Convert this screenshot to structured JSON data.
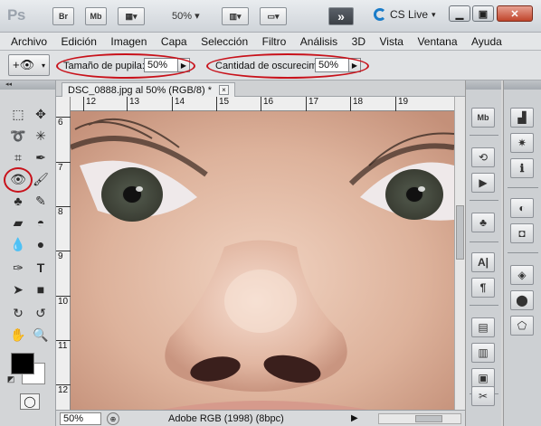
{
  "appbar": {
    "logo": "Ps",
    "br_label": "Br",
    "mb_label": "Mb",
    "zoom": "50%",
    "cs_live": "CS Live",
    "chevron": "»"
  },
  "menu": [
    "Archivo",
    "Edición",
    "Imagen",
    "Capa",
    "Selección",
    "Filtro",
    "Análisis",
    "3D",
    "Vista",
    "Ventana",
    "Ayuda"
  ],
  "options": {
    "pupil_label": "Tamaño de pupila:",
    "pupil_value": "50%",
    "darken_label": "Cantidad de oscurecimiento:",
    "darken_value": "50%"
  },
  "document": {
    "tab_title": "DSC_0888.jpg al 50% (RGB/8) *",
    "close": "×"
  },
  "rulers": {
    "top": [
      "12",
      "13",
      "14",
      "15",
      "16",
      "17",
      "18",
      "19"
    ],
    "left": [
      "6",
      "7",
      "8",
      "9",
      "10",
      "11",
      "12"
    ]
  },
  "status": {
    "zoom": "50%",
    "profile": "Adobe RGB (1998) (8bpc)"
  },
  "dock_labels": {
    "mb": "Mb"
  }
}
